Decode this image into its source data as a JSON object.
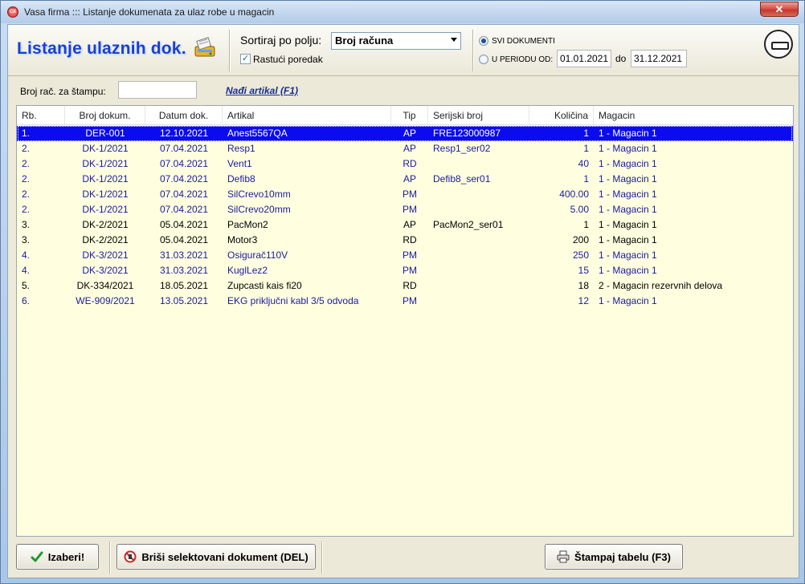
{
  "window": {
    "app_icon": "CX",
    "title": "Vasa firma ::: Listanje dokumenata za ulaz robe u magacin",
    "close": "✕"
  },
  "header": {
    "page_title": "Listanje ulaznih dok.",
    "sort_label": "Sortiraj po polju:",
    "sort_value": "Broj računa",
    "ascending_label": "Rastući poredak",
    "ascending_checked": true,
    "radio_all_label": "SVI DOKUMENTI",
    "radio_period_label": "U PERIODU OD:",
    "date_from": "01.01.2021",
    "date_to_label": "do",
    "date_to": "31.12.2021"
  },
  "filter": {
    "print_label": "Broj rač. za štampu:",
    "print_value": "",
    "find_link": "Nađi artikal (F1)"
  },
  "table": {
    "columns": [
      "Rb.",
      "Broj dokum.",
      "Datum dok.",
      "Artikal",
      "Tip",
      "Serijski broj",
      "Količina",
      "Magacin"
    ],
    "rows": [
      {
        "rb": "1.",
        "doc": "DER-001",
        "date": "12.10.2021",
        "art": "Anest5567QA",
        "tip": "AP",
        "ser": "FRE123000987",
        "qty": "1",
        "mag": "1 - Magacin 1",
        "selected": true,
        "tone": "dark"
      },
      {
        "rb": "2.",
        "doc": "DK-1/2021",
        "date": "07.04.2021",
        "art": "Resp1",
        "tip": "AP",
        "ser": "Resp1_ser02",
        "qty": "1",
        "mag": "1 - Magacin 1",
        "tone": "blue"
      },
      {
        "rb": "2.",
        "doc": "DK-1/2021",
        "date": "07.04.2021",
        "art": "Vent1",
        "tip": "RD",
        "ser": "",
        "qty": "40",
        "mag": "1 - Magacin 1",
        "tone": "blue"
      },
      {
        "rb": "2.",
        "doc": "DK-1/2021",
        "date": "07.04.2021",
        "art": "Defib8",
        "tip": "AP",
        "ser": "Defib8_ser01",
        "qty": "1",
        "mag": "1 - Magacin 1",
        "tone": "blue"
      },
      {
        "rb": "2.",
        "doc": "DK-1/2021",
        "date": "07.04.2021",
        "art": "SilCrevo10mm",
        "tip": "PM",
        "ser": "",
        "qty": "400.00",
        "mag": "1 - Magacin 1",
        "tone": "blue"
      },
      {
        "rb": "2.",
        "doc": "DK-1/2021",
        "date": "07.04.2021",
        "art": "SilCrevo20mm",
        "tip": "PM",
        "ser": "",
        "qty": "5.00",
        "mag": "1 - Magacin 1",
        "tone": "blue"
      },
      {
        "rb": "3.",
        "doc": "DK-2/2021",
        "date": "05.04.2021",
        "art": "PacMon2",
        "tip": "AP",
        "ser": "PacMon2_ser01",
        "qty": "1",
        "mag": "1 - Magacin 1",
        "tone": "dark"
      },
      {
        "rb": "3.",
        "doc": "DK-2/2021",
        "date": "05.04.2021",
        "art": "Motor3",
        "tip": "RD",
        "ser": "",
        "qty": "200",
        "mag": "1 - Magacin 1",
        "tone": "dark"
      },
      {
        "rb": "4.",
        "doc": "DK-3/2021",
        "date": "31.03.2021",
        "art": "Osigurač110V",
        "tip": "PM",
        "ser": "",
        "qty": "250",
        "mag": "1 - Magacin 1",
        "tone": "blue"
      },
      {
        "rb": "4.",
        "doc": "DK-3/2021",
        "date": "31.03.2021",
        "art": "KuglLez2",
        "tip": "PM",
        "ser": "",
        "qty": "15",
        "mag": "1 - Magacin 1",
        "tone": "blue"
      },
      {
        "rb": "5.",
        "doc": "DK-334/2021",
        "date": "18.05.2021",
        "art": "Zupcasti kais fi20",
        "tip": "RD",
        "ser": "",
        "qty": "18",
        "mag": "2 - Magacin rezervnih delova",
        "tone": "dark"
      },
      {
        "rb": "6.",
        "doc": "WE-909/2021",
        "date": "13.05.2021",
        "art": "EKG priključni kabl 3/5 odvoda",
        "tip": "PM",
        "ser": "",
        "qty": "12",
        "mag": "1 - Magacin 1",
        "tone": "blue"
      }
    ]
  },
  "footer": {
    "select_label": "Izaberi!",
    "delete_label": "Briši selektovani dokument (DEL)",
    "print_label": "Štampaj tabelu (F3)"
  },
  "icons": {
    "app": "app-logo-icon",
    "close": "close-icon",
    "scanner": "scanner-icon",
    "exit": "exit-icon",
    "check": "checkmark-icon",
    "delete": "delete-icon",
    "printer": "printer-icon"
  },
  "colors": {
    "title": "#1a3fd0",
    "selected_row": "#0b0bef",
    "grid_bg": "#ffffe0",
    "row_blue": "#1a1aa0"
  }
}
